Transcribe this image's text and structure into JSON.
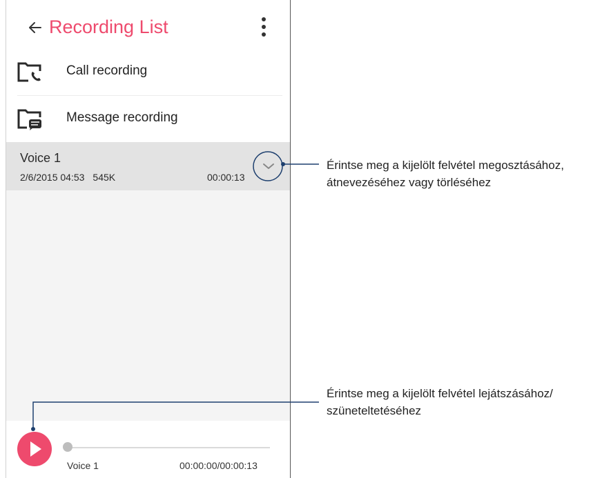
{
  "header": {
    "title": "Recording List",
    "back_icon": "arrow-left-icon",
    "menu_icon": "more-vert-icon"
  },
  "folders": [
    {
      "label": "Call recording",
      "icon": "call-folder-icon"
    },
    {
      "label": "Message recording",
      "icon": "message-folder-icon"
    }
  ],
  "recordings": [
    {
      "name": "Voice 1",
      "date": "2/6/2015 04:53",
      "size": "545K",
      "duration": "00:00:13"
    }
  ],
  "player": {
    "name": "Voice 1",
    "time": "00:00:00/00:00:13",
    "progress": 0
  },
  "annotations": {
    "expand": [
      "Érintse meg a kijelölt felvétel megosztásához,",
      "átnevezéséhez vagy törléséhez"
    ],
    "play": [
      "Érintse meg a kijelölt felvétel lejátszásához/",
      "szüneteltetéséhez"
    ]
  },
  "colors": {
    "accent": "#ee4a6d",
    "callout": "#1d3f6e"
  }
}
